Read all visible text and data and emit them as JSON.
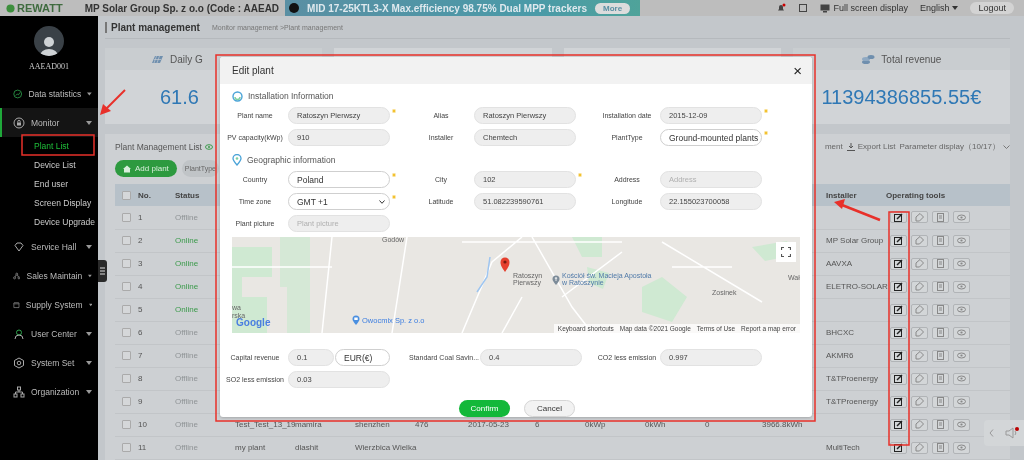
{
  "topbar": {
    "logo": "REWATT",
    "company": "MP Solar Group Sp. z o.o (Code : AAEAD",
    "banner": "MID 17-25KTL3-X  Max.efficiency 98.75%  Dual MPP trackers",
    "banner_button": "More",
    "fullscreen": "Full screen display",
    "language": "English",
    "logout": "Logout"
  },
  "sidebar": {
    "user": "AAEAD001",
    "items": [
      {
        "label": "Data statistics",
        "selected": false
      },
      {
        "label": "Monitor",
        "selected": true,
        "children": [
          {
            "label": "Plant List",
            "selected": true
          },
          {
            "label": "Device List",
            "selected": false
          },
          {
            "label": "End user",
            "selected": false
          },
          {
            "label": "Screen Display",
            "selected": false
          },
          {
            "label": "Device Upgrade",
            "selected": false
          }
        ]
      },
      {
        "label": "Service Hall",
        "selected": false
      },
      {
        "label": "Sales Maintain",
        "selected": false
      },
      {
        "label": "Supply System",
        "selected": false
      },
      {
        "label": "User Center",
        "selected": false
      },
      {
        "label": "System Set",
        "selected": false
      },
      {
        "label": "Organization",
        "selected": false
      }
    ]
  },
  "page": {
    "title": "Plant management",
    "breadcrumb": "Monitor management >Plant management"
  },
  "cards": [
    {
      "title": "Daily G",
      "value": "61.6"
    },
    {
      "title": "Total revenue",
      "value": "11394386855.55€"
    }
  ],
  "list": {
    "title": "Plant Management List",
    "add_button": "Add plant",
    "filter": "PlantType",
    "actions": [
      "ment",
      "Export List",
      "Parameter display（10/17）"
    ]
  },
  "table": {
    "all_checked": false,
    "columns": [
      "No.",
      "Status",
      "Installer",
      "Operating tools"
    ],
    "rows": [
      {
        "checked": false,
        "no": "1",
        "status": "Offline",
        "online": false,
        "installer": ""
      },
      {
        "checked": false,
        "no": "2",
        "status": "Online",
        "online": true,
        "installer": "MP Solar Group"
      },
      {
        "checked": false,
        "no": "3",
        "status": "Online",
        "online": true,
        "installer": "AAVXA"
      },
      {
        "checked": false,
        "no": "4",
        "status": "Online",
        "online": true,
        "installer": "ELETRO-SOLAR"
      },
      {
        "checked": false,
        "no": "5",
        "status": "Online",
        "online": true,
        "installer": ""
      },
      {
        "checked": false,
        "no": "6",
        "status": "Offline",
        "online": false,
        "installer": "BHCXC"
      },
      {
        "checked": false,
        "no": "7",
        "status": "Offline",
        "online": false,
        "installer": "AKMR6"
      },
      {
        "checked": false,
        "no": "8",
        "status": "Offline",
        "online": false,
        "installer": "T&TProenergy"
      },
      {
        "checked": false,
        "no": "9",
        "status": "Offline",
        "online": false,
        "installer": "T&TProenergy"
      },
      {
        "checked": false,
        "no": "10",
        "status": "Offline",
        "online": false,
        "cells": [
          "Test_Test_13_19",
          "mamira",
          "shenzhen",
          "476",
          "2017-05-23",
          "6",
          "0kWp",
          "0kWh",
          "0",
          "3966.8kWh"
        ],
        "installer": ""
      },
      {
        "checked": false,
        "no": "11",
        "status": "Offline",
        "online": false,
        "cells": [
          "my plant",
          "dlashit",
          "Wierzbica Wielka"
        ],
        "installer": "MultiTech"
      }
    ]
  },
  "modal": {
    "title": "Edit plant",
    "close": "×",
    "sections": [
      {
        "kind": "installation",
        "title": "Installation Information",
        "rows": [
          [
            {
              "label": "Plant name",
              "kind": "input",
              "value": "Ratoszyn Pierwszy",
              "editable": false,
              "required": true
            },
            {
              "label": "Alias",
              "kind": "input",
              "value": "Ratoszyn Pierwszy",
              "editable": false,
              "required": false
            },
            {
              "label": "Installation date",
              "kind": "input",
              "value": "2015-12-09",
              "editable": false,
              "required": true
            }
          ],
          [
            {
              "label": "PV capacity(kWp)",
              "kind": "input",
              "value": "910",
              "editable": false,
              "required": false
            },
            {
              "label": "Installer",
              "kind": "input",
              "value": "Chemtech",
              "editable": false,
              "required": false
            },
            {
              "label": "PlantType",
              "kind": "select",
              "value": "Ground-mounted plants",
              "editable": true,
              "required": true
            }
          ]
        ]
      },
      {
        "kind": "geographic",
        "title": "Geographic information",
        "rows": [
          [
            {
              "label": "Country",
              "kind": "input",
              "value": "Poland",
              "editable": true,
              "required": true
            },
            {
              "label": "City",
              "kind": "input",
              "value": "102",
              "editable": false,
              "required": true
            },
            {
              "label": "Address",
              "kind": "input",
              "placeholder": "Address",
              "editable": false,
              "required": false
            }
          ],
          [
            {
              "label": "Time zone",
              "kind": "select",
              "value": "GMT +1",
              "editable": true,
              "required": true
            },
            {
              "label": "Latitude",
              "kind": "input",
              "value": "51.082239590761",
              "editable": false,
              "required": false
            },
            {
              "label": "Longitude",
              "kind": "input",
              "value": "22.155023700058",
              "editable": false,
              "required": false
            }
          ],
          [
            {
              "label": "Plant picture",
              "kind": "input",
              "placeholder": "Plant picture",
              "editable": false,
              "required": false
            }
          ]
        ]
      }
    ],
    "map": {
      "labels": [
        "Godów",
        "Ratoszyn Pierwszy",
        "Kościół św. Macieja Apostoła w Ratoszynie",
        "Zosinek",
        "Wał",
        "wa",
        "rska"
      ],
      "business": "Owocmix Sp. z o.o",
      "logo": "Google",
      "footer": [
        "Keyboard shortcuts",
        "Map data ©2021 Google",
        "Terms of Use",
        "Report a map error"
      ]
    },
    "extra_rows": [
      [
        {
          "label": "Capital revenue",
          "kind": "input",
          "value": "0.1",
          "editable": false,
          "required": false,
          "unit": "EUR(€)"
        },
        {
          "label": "Standard Coal Savin...",
          "kind": "input",
          "value": "0.4",
          "editable": false,
          "required": false
        },
        {
          "label": "CO2 less emission",
          "kind": "input",
          "value": "0.997",
          "editable": false,
          "required": false
        }
      ],
      [
        {
          "label": "SO2 less emission",
          "kind": "input",
          "value": "0.03",
          "editable": false,
          "required": false
        }
      ]
    ],
    "buttons": [
      {
        "label": "Confirm",
        "kind": "primary"
      },
      {
        "label": "Cancel",
        "kind": "secondary"
      }
    ]
  }
}
